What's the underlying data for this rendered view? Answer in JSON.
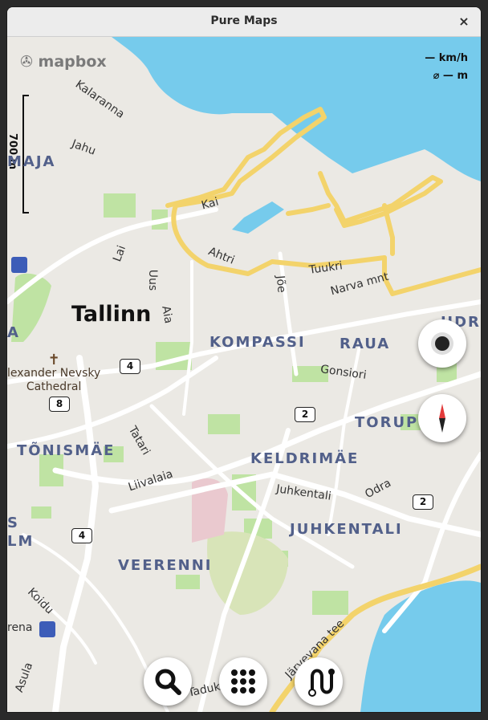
{
  "window": {
    "title": "Pure Maps",
    "close_label": "×"
  },
  "attribution": "mapbox",
  "speed": {
    "speed_text": "— km/h",
    "distance_text": "⌀ — m"
  },
  "scale": {
    "label": "700 m"
  },
  "labels": {
    "city": "Tallinn",
    "districts": [
      "MAJA",
      "KOMPASSI",
      "RAUA",
      "TORUP",
      "TÕNISMÄE",
      "KELDRIMÄE",
      "JUHKENTALI",
      "VEERENNI",
      "S",
      "LM",
      "A",
      "HDR"
    ],
    "streets": [
      "Kalaranna",
      "Jahu",
      "Kai",
      "Lai",
      "Uus",
      "Aia",
      "Ahtri",
      "Tuukri",
      "Jõe",
      "Narva mnt",
      "Gonsiori",
      "Tatari",
      "Liivalaia",
      "Juhkentali",
      "Odra",
      "Koidu",
      "Järvevana tee",
      "Asula",
      "Tadukt",
      "rena"
    ],
    "pois": [
      "lexander Nevsky",
      "Cathedral"
    ]
  },
  "road_shields": [
    "4",
    "8",
    "2",
    "2",
    "4"
  ],
  "controls": {
    "follow": "center-location-button",
    "compass": "compass-button",
    "search": "search-button",
    "menu": "menu-button",
    "navigation": "navigation-button"
  },
  "colors": {
    "water": "#76cbec",
    "land": "#ebe9e4",
    "park": "#bfe3a3",
    "route": "#f3d36b",
    "district_text": "#52608a",
    "transit": "#3d5db8"
  }
}
